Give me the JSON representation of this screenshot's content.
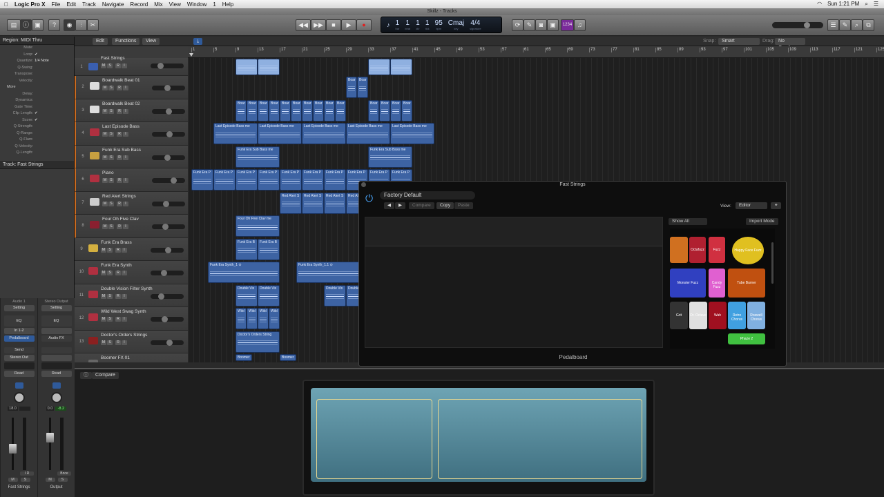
{
  "menubar": {
    "app": "Logic Pro X",
    "items": [
      "File",
      "Edit",
      "Track",
      "Navigate",
      "Record",
      "Mix",
      "View",
      "Window",
      "1",
      "Help"
    ],
    "clock": "Sun 1:21 PM"
  },
  "window": {
    "title": "Skillz - Tracks"
  },
  "lcd": {
    "bar": "1",
    "beat": "1",
    "div": "1",
    "tick": "1",
    "tempo": "95",
    "key": "Cmaj",
    "signature": "4/4",
    "labels": [
      "bar",
      "beat",
      "div",
      "tick",
      "bpm",
      "key",
      "signature"
    ]
  },
  "countin": "1234",
  "toolbar": {
    "edit": "Edit",
    "functions": "Functions",
    "view": "View",
    "snap_label": "Snap:",
    "snap": "Smart",
    "drag_label": "Drag:",
    "drag": "No Overlap"
  },
  "inspector": {
    "region_header": "Region: MIDI Thru",
    "rows": [
      {
        "k": "Mute:",
        "v": ""
      },
      {
        "k": "Loop:",
        "v": "✔"
      },
      {
        "k": "Quantize:",
        "v": "1/4 Note"
      },
      {
        "k": "Q-Swing:",
        "v": ""
      },
      {
        "k": "Transpose:",
        "v": ""
      },
      {
        "k": "Velocity:",
        "v": ""
      }
    ],
    "more": "More",
    "more_rows": [
      {
        "k": "Delay:",
        "v": ""
      },
      {
        "k": "Dynamics:",
        "v": ""
      },
      {
        "k": "Gate Time:",
        "v": ""
      },
      {
        "k": "Clip Length:",
        "v": "✔"
      },
      {
        "k": "Score:",
        "v": "✔"
      },
      {
        "k": "Q-Strength:",
        "v": ""
      },
      {
        "k": "Q-Range:",
        "v": ""
      },
      {
        "k": "Q-Flam:",
        "v": ""
      },
      {
        "k": "Q-Velocity:",
        "v": ""
      },
      {
        "k": "Q-Length:",
        "v": ""
      }
    ],
    "track_header": "Track: Fast Strings"
  },
  "strips": [
    {
      "top": "Audio 1",
      "setting": "Setting",
      "eq": "EQ",
      "input": "In 1-2",
      "insert": "Pedalboard",
      "send": "Send",
      "output": "Stereo Out",
      "auto": "Read",
      "vol": "18.0",
      "peak": "",
      "ir": "I  R",
      "name": "Fast Strings"
    },
    {
      "top": "Stereo Output",
      "setting": "Setting",
      "eq": "EQ",
      "input": "",
      "insert": "Audio FX",
      "send": "",
      "output": "",
      "auto": "Read",
      "vol": "0.0",
      "peak": "-8.2",
      "ir": "Bnce",
      "name": "Output"
    }
  ],
  "msri": [
    "M",
    "S",
    "R",
    "I"
  ],
  "tracks": [
    {
      "n": "1",
      "name": "Fast Strings",
      "icon": "#3a5fb0",
      "vol": 0.25,
      "regions": [
        {
          "s": 9,
          "e": 13,
          "t": "",
          "sel": true
        },
        {
          "s": 13,
          "e": 17,
          "t": "",
          "sel": true
        },
        {
          "s": 33,
          "e": 37,
          "t": "",
          "sel": true
        },
        {
          "s": 37,
          "e": 41,
          "t": "",
          "sel": true
        }
      ]
    },
    {
      "n": "2",
      "name": "Boardwalk Beat 01",
      "icon": "#ddd",
      "vol": 0.45,
      "regions": [
        {
          "s": 29,
          "e": 31,
          "t": "Boar"
        },
        {
          "s": 31,
          "e": 33,
          "t": "Boar"
        }
      ]
    },
    {
      "n": "3",
      "name": "Boardwalk Beat 02",
      "icon": "#ddd",
      "vol": 0.5,
      "regions": [
        {
          "s": 9,
          "e": 11,
          "t": "Boar"
        },
        {
          "s": 11,
          "e": 13,
          "t": "Boar"
        },
        {
          "s": 13,
          "e": 15,
          "t": "Boar"
        },
        {
          "s": 15,
          "e": 17,
          "t": "Boar"
        },
        {
          "s": 17,
          "e": 19,
          "t": "Boar"
        },
        {
          "s": 19,
          "e": 21,
          "t": "Boar"
        },
        {
          "s": 21,
          "e": 23,
          "t": "Boar"
        },
        {
          "s": 23,
          "e": 25,
          "t": "Boar"
        },
        {
          "s": 25,
          "e": 27,
          "t": "Boar"
        },
        {
          "s": 27,
          "e": 29,
          "t": "Boar"
        },
        {
          "s": 33,
          "e": 35,
          "t": "Boar"
        },
        {
          "s": 35,
          "e": 37,
          "t": "Boar"
        },
        {
          "s": 37,
          "e": 39,
          "t": "Boar"
        },
        {
          "s": 39,
          "e": 41,
          "t": "Boar"
        }
      ]
    },
    {
      "n": "4",
      "name": "Last Episode Bass",
      "icon": "#b03040",
      "vol": 0.55,
      "regions": [
        {
          "s": 5,
          "e": 13,
          "t": "Last Episode Bass me"
        },
        {
          "s": 13,
          "e": 21,
          "t": "Last Episode Bass me"
        },
        {
          "s": 21,
          "e": 29,
          "t": "Last Episode Bass me"
        },
        {
          "s": 29,
          "e": 37,
          "t": "Last Episode Bass me"
        },
        {
          "s": 37,
          "e": 45,
          "t": "Last Episode Bass me"
        }
      ]
    },
    {
      "n": "5",
      "name": "Funk Era Sub Bass",
      "icon": "#c8a040",
      "vol": 0.45,
      "regions": [
        {
          "s": 9,
          "e": 17,
          "t": "Funk Era Sub Bass me"
        },
        {
          "s": 33,
          "e": 41,
          "t": "Funk Era Sub Bass me"
        }
      ]
    },
    {
      "n": "6",
      "name": "Piano",
      "icon": "#b03040",
      "vol": 0.7,
      "regions": [
        {
          "s": 1,
          "e": 5,
          "t": "Funk Era P"
        },
        {
          "s": 5,
          "e": 9,
          "t": "Funk Era P"
        },
        {
          "s": 9,
          "e": 13,
          "t": "Funk Era P"
        },
        {
          "s": 13,
          "e": 17,
          "t": "Funk Era P"
        },
        {
          "s": 17,
          "e": 21,
          "t": "Funk Era P"
        },
        {
          "s": 21,
          "e": 25,
          "t": "Funk Era P"
        },
        {
          "s": 25,
          "e": 29,
          "t": "Funk Era P"
        },
        {
          "s": 29,
          "e": 33,
          "t": "Funk Era P"
        },
        {
          "s": 33,
          "e": 37,
          "t": "Funk Era P"
        },
        {
          "s": 37,
          "e": 41,
          "t": "Funk Era P"
        }
      ]
    },
    {
      "n": "7",
      "name": "Red Alert Strings",
      "icon": "#ccc",
      "vol": 0.4,
      "regions": [
        {
          "s": 17,
          "e": 21,
          "t": "Red Alert S"
        },
        {
          "s": 21,
          "e": 25,
          "t": "Red Alert S"
        },
        {
          "s": 25,
          "e": 29,
          "t": "Red Alert S"
        },
        {
          "s": 29,
          "e": 33,
          "t": "Red Alert S"
        }
      ]
    },
    {
      "n": "8",
      "name": "Four Oh Five Clav",
      "icon": "#8a2030",
      "vol": 0.38,
      "regions": [
        {
          "s": 9,
          "e": 17,
          "t": "Four Oh Five Clav me"
        }
      ]
    },
    {
      "n": "9",
      "name": "Funk Era Brass",
      "icon": "#d4b040",
      "vol": 0.55,
      "regions": [
        {
          "s": 9,
          "e": 13,
          "t": "Funk Era B"
        },
        {
          "s": 13,
          "e": 17,
          "t": "Funk Era B"
        }
      ]
    },
    {
      "n": "10",
      "name": "Funk Era Synth",
      "icon": "#b03040",
      "vol": 0.38,
      "regions": [
        {
          "s": 4,
          "e": 17,
          "t": "Funk Era Synth_1  ⊙"
        },
        {
          "s": 20,
          "e": 33,
          "t": "Funk Era Synth_1.1  ⊙"
        }
      ]
    },
    {
      "n": "11",
      "name": "Double Vision Filter Synth",
      "icon": "#b03040",
      "vol": 0.28,
      "regions": [
        {
          "s": 9,
          "e": 13,
          "t": "Double Vis"
        },
        {
          "s": 13,
          "e": 17,
          "t": "Double Vis"
        },
        {
          "s": 25,
          "e": 29,
          "t": "Double Vis"
        },
        {
          "s": 29,
          "e": 33,
          "t": "Double"
        }
      ]
    },
    {
      "n": "12",
      "name": "Wild West Swag Synth",
      "icon": "#b03040",
      "vol": 0.4,
      "regions": [
        {
          "s": 9,
          "e": 11,
          "t": "Wild"
        },
        {
          "s": 11,
          "e": 13,
          "t": "Wild"
        },
        {
          "s": 13,
          "e": 15,
          "t": "Wild"
        },
        {
          "s": 15,
          "e": 17,
          "t": "Wild"
        }
      ]
    },
    {
      "n": "13",
      "name": "Doctor's Orders Strings",
      "icon": "#8a2020",
      "vol": 0.6,
      "regions": [
        {
          "s": 9,
          "e": 17,
          "t": "Doctor's Orders String"
        }
      ]
    },
    {
      "n": "14",
      "name": "Boomer FX 01",
      "icon": "#666",
      "vol": 0.5,
      "regions": [
        {
          "s": 9,
          "e": 12,
          "t": "Boomer"
        },
        {
          "s": 17,
          "e": 20,
          "t": "Boomer"
        }
      ]
    }
  ],
  "ruler": [
    "1",
    "5",
    "9",
    "13",
    "17",
    "21",
    "25",
    "29",
    "33",
    "37",
    "41",
    "45",
    "49",
    "53",
    "57",
    "61",
    "65",
    "69",
    "73",
    "77",
    "81",
    "85",
    "89",
    "93",
    "97",
    "101",
    "105",
    "109",
    "113",
    "117",
    "121",
    "125"
  ],
  "plugin": {
    "title": "Fast Strings",
    "preset": "Factory Default",
    "compare": "Compare",
    "copy": "Copy",
    "paste": "Paste",
    "view_label": "View:",
    "view": "Editor",
    "show_all": "Show All",
    "import_mode": "Import Mode",
    "footer": "Pedalboard",
    "pedals": [
      {
        "name": "Octafuzz",
        "color": "#b02030"
      },
      {
        "name": "Fuzz",
        "color": "#d03040"
      },
      {
        "name": "Happy Face Fuzz",
        "color": "#e0c020"
      },
      {
        "name": "Monster Fuzz",
        "color": "#3040c0"
      },
      {
        "name": "Candy Fuzz",
        "color": "#e060d0"
      },
      {
        "name": "Tube Burner",
        "color": "#c05010"
      },
      {
        "name": "Grit",
        "color": "#333"
      },
      {
        "name": "Dr. Octave",
        "color": "#e0e0e0"
      },
      {
        "name": "Wah",
        "color": "#a01020"
      },
      {
        "name": "Retro Chorus",
        "color": "#40a0e0"
      },
      {
        "name": "Roswell Chorus",
        "color": "#80b0e0"
      },
      {
        "name": "Phaze 2",
        "color": "#40c040"
      }
    ]
  },
  "bottom": {
    "compare": "Compare"
  }
}
